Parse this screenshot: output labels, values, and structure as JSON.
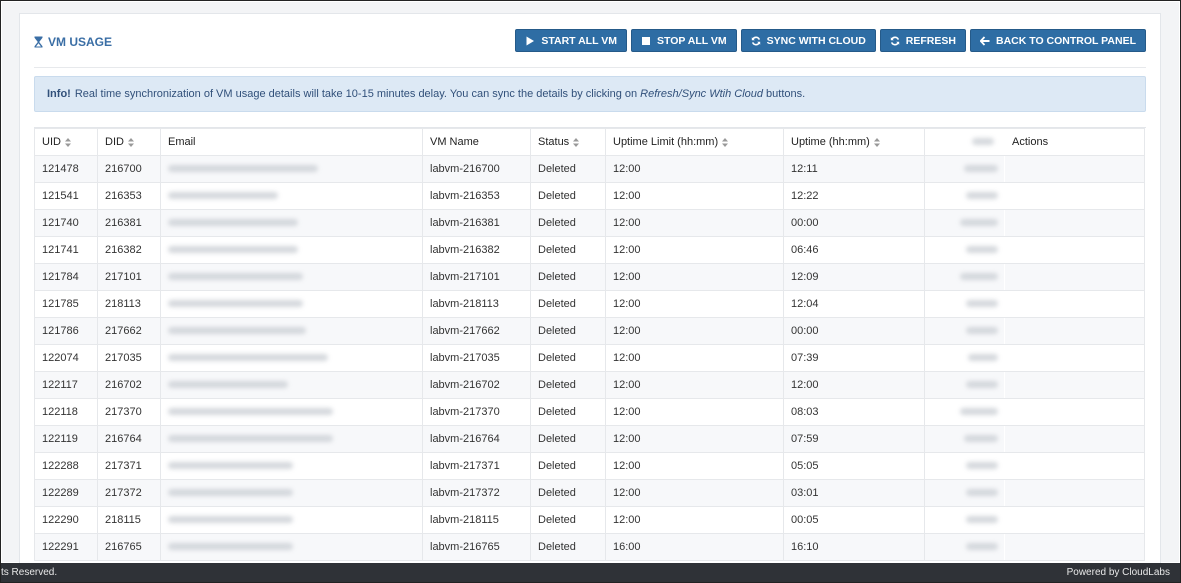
{
  "header": {
    "title": "VM USAGE",
    "title_icon": "hourglass-icon"
  },
  "buttons": {
    "start_all": "START ALL VM",
    "stop_all": "STOP ALL VM",
    "sync_cloud": "SYNC WITH CLOUD",
    "refresh": "REFRESH",
    "back": "BACK TO CONTROL PANEL",
    "accent_color": "#2e6da4"
  },
  "info": {
    "label": "Info!",
    "text_before": "Real time synchronization of VM usage details will take 10-15 minutes delay. You can sync the details by clicking on",
    "emphasis": "Refresh/Sync Wtih Cloud",
    "text_after": "buttons."
  },
  "table": {
    "columns": [
      "UID",
      "DID",
      "Email",
      "VM Name",
      "Status",
      "Uptime Limit (hh:mm)",
      "Uptime (hh:mm)",
      "",
      "Actions"
    ],
    "rows": [
      {
        "uid": "121478",
        "did": "216700",
        "vm": "labvm-216700",
        "status": "Deleted",
        "limit": "12:00",
        "uptime": "12:11"
      },
      {
        "uid": "121541",
        "did": "216353",
        "vm": "labvm-216353",
        "status": "Deleted",
        "limit": "12:00",
        "uptime": "12:22"
      },
      {
        "uid": "121740",
        "did": "216381",
        "vm": "labvm-216381",
        "status": "Deleted",
        "limit": "12:00",
        "uptime": "00:00"
      },
      {
        "uid": "121741",
        "did": "216382",
        "vm": "labvm-216382",
        "status": "Deleted",
        "limit": "12:00",
        "uptime": "06:46"
      },
      {
        "uid": "121784",
        "did": "217101",
        "vm": "labvm-217101",
        "status": "Deleted",
        "limit": "12:00",
        "uptime": "12:09"
      },
      {
        "uid": "121785",
        "did": "218113",
        "vm": "labvm-218113",
        "status": "Deleted",
        "limit": "12:00",
        "uptime": "12:04"
      },
      {
        "uid": "121786",
        "did": "217662",
        "vm": "labvm-217662",
        "status": "Deleted",
        "limit": "12:00",
        "uptime": "00:00"
      },
      {
        "uid": "122074",
        "did": "217035",
        "vm": "labvm-217035",
        "status": "Deleted",
        "limit": "12:00",
        "uptime": "07:39"
      },
      {
        "uid": "122117",
        "did": "216702",
        "vm": "labvm-216702",
        "status": "Deleted",
        "limit": "12:00",
        "uptime": "12:00"
      },
      {
        "uid": "122118",
        "did": "217370",
        "vm": "labvm-217370",
        "status": "Deleted",
        "limit": "12:00",
        "uptime": "08:03"
      },
      {
        "uid": "122119",
        "did": "216764",
        "vm": "labvm-216764",
        "status": "Deleted",
        "limit": "12:00",
        "uptime": "07:59"
      },
      {
        "uid": "122288",
        "did": "217371",
        "vm": "labvm-217371",
        "status": "Deleted",
        "limit": "12:00",
        "uptime": "05:05"
      },
      {
        "uid": "122289",
        "did": "217372",
        "vm": "labvm-217372",
        "status": "Deleted",
        "limit": "12:00",
        "uptime": "03:01"
      },
      {
        "uid": "122290",
        "did": "218115",
        "vm": "labvm-218115",
        "status": "Deleted",
        "limit": "12:00",
        "uptime": "00:05"
      },
      {
        "uid": "122291",
        "did": "216765",
        "vm": "labvm-216765",
        "status": "Deleted",
        "limit": "16:00",
        "uptime": "16:10"
      }
    ]
  },
  "footer": {
    "left": "ts Reserved.",
    "right": "Powered by CloudLabs"
  }
}
